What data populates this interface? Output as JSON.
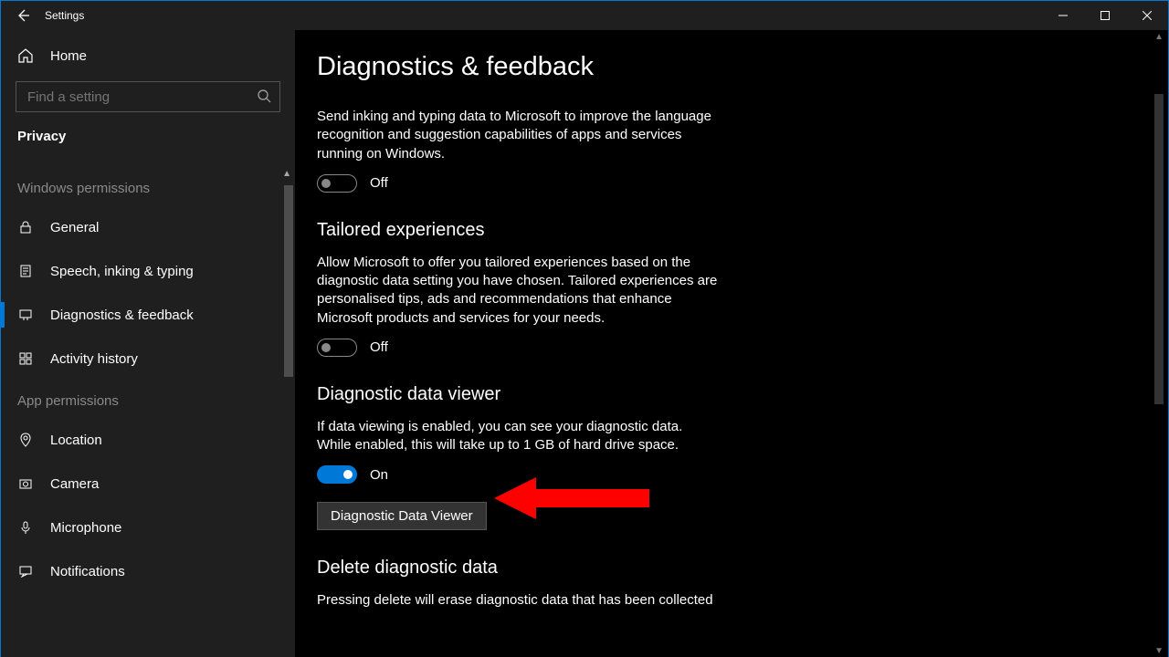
{
  "window": {
    "title": "Settings"
  },
  "sidebar": {
    "home": "Home",
    "search_placeholder": "Find a setting",
    "section": "Privacy",
    "group1": "Windows permissions",
    "group2": "App permissions",
    "items1": [
      {
        "label": "General"
      },
      {
        "label": "Speech, inking & typing"
      },
      {
        "label": "Diagnostics & feedback"
      },
      {
        "label": "Activity history"
      }
    ],
    "items2": [
      {
        "label": "Location"
      },
      {
        "label": "Camera"
      },
      {
        "label": "Microphone"
      },
      {
        "label": "Notifications"
      }
    ]
  },
  "main": {
    "title": "Diagnostics & feedback",
    "inking_text": "Send inking and typing data to Microsoft to improve the language recognition and suggestion capabilities of apps and services running on Windows.",
    "off": "Off",
    "on": "On",
    "tailored_h": "Tailored experiences",
    "tailored_text": "Allow Microsoft to offer you tailored experiences based on the diagnostic data setting you have chosen. Tailored experiences are personalised tips, ads and recommendations that enhance Microsoft products and services for your needs.",
    "viewer_h": "Diagnostic data viewer",
    "viewer_text": "If data viewing is enabled, you can see your diagnostic data. While enabled, this will take up to 1 GB of hard drive space.",
    "viewer_btn": "Diagnostic Data Viewer",
    "delete_h": "Delete diagnostic data",
    "delete_text": "Pressing delete will erase diagnostic data that has been collected"
  }
}
